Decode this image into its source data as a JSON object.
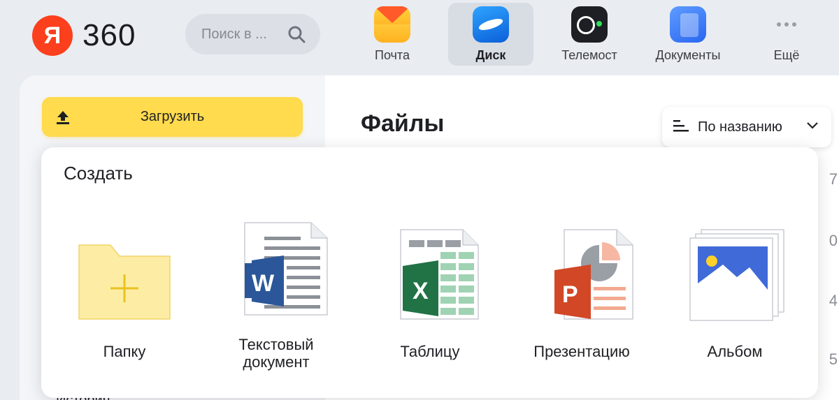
{
  "header": {
    "logo_letter": "Я",
    "logo_text": "360",
    "search_placeholder": "Поиск в ...",
    "apps": [
      {
        "label": "Почта",
        "icon": "mail-icon",
        "active": false
      },
      {
        "label": "Диск",
        "icon": "disk-icon",
        "active": true
      },
      {
        "label": "Телемост",
        "icon": "telemost-icon",
        "active": false
      },
      {
        "label": "Документы",
        "icon": "documents-icon",
        "active": false
      },
      {
        "label": "Ещё",
        "icon": "more-icon",
        "active": false
      }
    ]
  },
  "sidebar": {
    "upload_label": "Загрузить",
    "peek_label": "История"
  },
  "main": {
    "title": "Файлы",
    "sort_label": "По названию",
    "edge_digits": [
      "7",
      "0",
      "4",
      "5"
    ]
  },
  "create_menu": {
    "title": "Создать",
    "items": [
      {
        "label": "Папку",
        "icon": "folder-plus-icon"
      },
      {
        "label_line1": "Текстовый",
        "label_line2": "документ",
        "icon": "word-document-icon"
      },
      {
        "label": "Таблицу",
        "icon": "excel-table-icon"
      },
      {
        "label": "Презентацию",
        "icon": "powerpoint-presentation-icon"
      },
      {
        "label": "Альбом",
        "icon": "album-icon"
      }
    ]
  },
  "colors": {
    "accent_yellow": "#ffdb4d",
    "logo_red": "#fc3f1d",
    "word_blue": "#2b579a",
    "excel_green": "#217346",
    "powerpoint_red": "#d24726"
  }
}
